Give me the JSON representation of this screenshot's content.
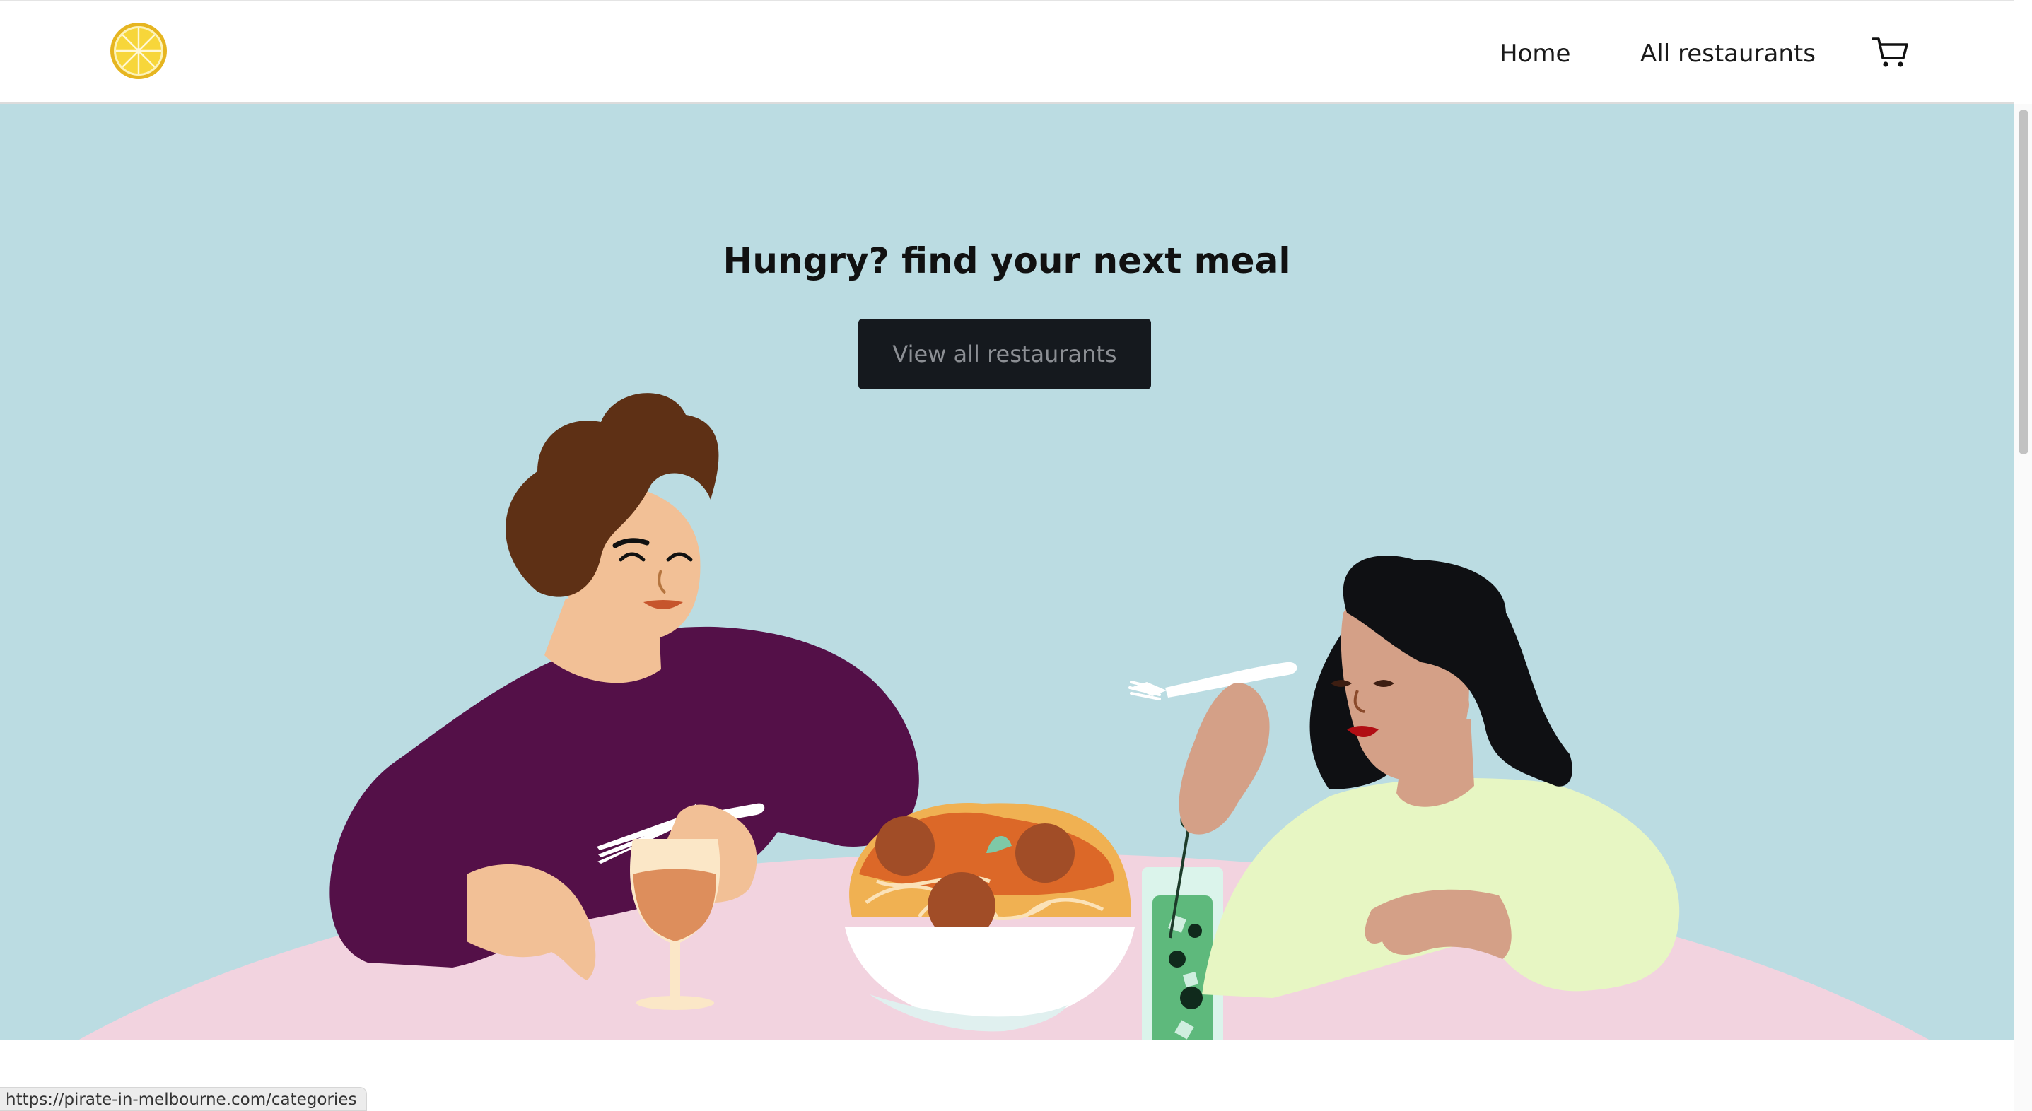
{
  "nav": {
    "home_label": "Home",
    "all_restaurants_label": "All restaurants"
  },
  "hero": {
    "title": "Hungry? find your next meal",
    "button_label": "View all restaurants"
  },
  "status_bar": {
    "url": "https://pirate-in-melbourne.com/categories"
  },
  "icons": {
    "logo": "lemon-slice-logo",
    "cart": "shopping-cart-icon"
  },
  "colors": {
    "hero_background": "#bbdce2",
    "table": "#f2d3df",
    "button_background": "#15191e",
    "button_text": "#8c8f94",
    "logo_yellow": "#f5d83b"
  }
}
